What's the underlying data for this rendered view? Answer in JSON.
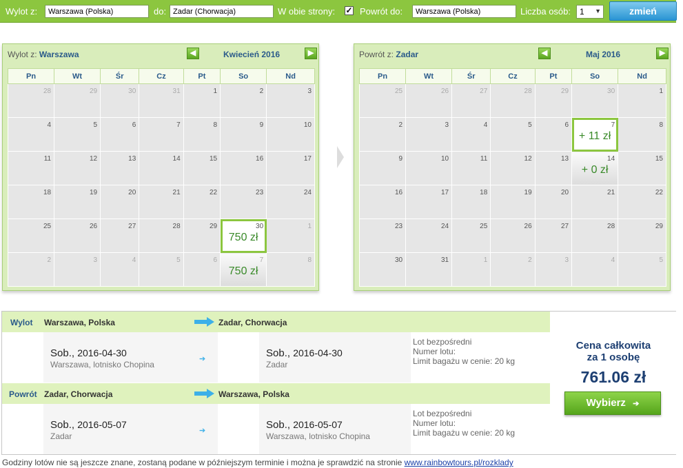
{
  "search": {
    "from_label": "Wylot z:",
    "from_value": "Warszawa (Polska)",
    "to_label": "do:",
    "to_value": "Zadar (Chorwacja)",
    "roundtrip_label": "W obie strony:",
    "roundtrip_checked": true,
    "return_label": "Powrót do:",
    "return_value": "Warszawa (Polska)",
    "persons_label": "Liczba osób:",
    "persons_value": "1",
    "change_button": "zmień"
  },
  "colors": {
    "accent": "#8cc63f",
    "price_green": "#3a8a2a",
    "navy": "#1d3f72",
    "blue_arrow": "#3cb0e8"
  },
  "weekdays": [
    "Pn",
    "Wt",
    "Śr",
    "Cz",
    "Pt",
    "So",
    "Nd"
  ],
  "calendars": [
    {
      "title_prefix": "Wylot z:",
      "title_city": "Warszawa",
      "month": "Kwiecień 2016",
      "weeks": [
        [
          {
            "d": "28",
            "o": true
          },
          {
            "d": "29",
            "o": true
          },
          {
            "d": "30",
            "o": true
          },
          {
            "d": "31",
            "o": true
          },
          {
            "d": "1"
          },
          {
            "d": "2"
          },
          {
            "d": "3"
          }
        ],
        [
          {
            "d": "4"
          },
          {
            "d": "5"
          },
          {
            "d": "6"
          },
          {
            "d": "7"
          },
          {
            "d": "8"
          },
          {
            "d": "9"
          },
          {
            "d": "10"
          }
        ],
        [
          {
            "d": "11"
          },
          {
            "d": "12"
          },
          {
            "d": "13"
          },
          {
            "d": "14"
          },
          {
            "d": "15"
          },
          {
            "d": "16"
          },
          {
            "d": "17"
          }
        ],
        [
          {
            "d": "18"
          },
          {
            "d": "19"
          },
          {
            "d": "20"
          },
          {
            "d": "21"
          },
          {
            "d": "22"
          },
          {
            "d": "23"
          },
          {
            "d": "24"
          }
        ],
        [
          {
            "d": "25"
          },
          {
            "d": "26"
          },
          {
            "d": "27"
          },
          {
            "d": "28"
          },
          {
            "d": "29"
          },
          {
            "d": "30",
            "price": "750 zł",
            "sel": true
          },
          {
            "d": "1",
            "o": true
          }
        ],
        [
          {
            "d": "2",
            "o": true
          },
          {
            "d": "3",
            "o": true
          },
          {
            "d": "4",
            "o": true
          },
          {
            "d": "5",
            "o": true
          },
          {
            "d": "6",
            "o": true
          },
          {
            "d": "7",
            "o": true,
            "price": "750 zł"
          },
          {
            "d": "8",
            "o": true
          }
        ]
      ]
    },
    {
      "title_prefix": "Powrót z:",
      "title_city": "Zadar",
      "month": "Maj 2016",
      "weeks": [
        [
          {
            "d": "25",
            "o": true
          },
          {
            "d": "26",
            "o": true
          },
          {
            "d": "27",
            "o": true
          },
          {
            "d": "28",
            "o": true
          },
          {
            "d": "29",
            "o": true
          },
          {
            "d": "30",
            "o": true
          },
          {
            "d": "1"
          }
        ],
        [
          {
            "d": "2"
          },
          {
            "d": "3"
          },
          {
            "d": "4"
          },
          {
            "d": "5"
          },
          {
            "d": "6"
          },
          {
            "d": "7",
            "price": "+ 11 zł",
            "sel": true
          },
          {
            "d": "8"
          }
        ],
        [
          {
            "d": "9"
          },
          {
            "d": "10"
          },
          {
            "d": "11"
          },
          {
            "d": "12"
          },
          {
            "d": "13"
          },
          {
            "d": "14",
            "price": "+ 0 zł"
          },
          {
            "d": "15"
          }
        ],
        [
          {
            "d": "16"
          },
          {
            "d": "17"
          },
          {
            "d": "18"
          },
          {
            "d": "19"
          },
          {
            "d": "20"
          },
          {
            "d": "21"
          },
          {
            "d": "22"
          }
        ],
        [
          {
            "d": "23"
          },
          {
            "d": "24"
          },
          {
            "d": "25"
          },
          {
            "d": "26"
          },
          {
            "d": "27"
          },
          {
            "d": "28"
          },
          {
            "d": "29"
          }
        ],
        [
          {
            "d": "30"
          },
          {
            "d": "31"
          },
          {
            "d": "1",
            "o": true
          },
          {
            "d": "2",
            "o": true
          },
          {
            "d": "3",
            "o": true
          },
          {
            "d": "4",
            "o": true
          },
          {
            "d": "5",
            "o": true
          }
        ]
      ]
    }
  ],
  "summary": {
    "outbound": {
      "leg_label": "Wylot",
      "from": "Warszawa, Polska",
      "to": "Zadar, Chorwacja",
      "dep_day": "Sob.,",
      "dep_date": "2016-04-30",
      "dep_place": "Warszawa, lotnisko Chopina",
      "arr_day": "Sob.,",
      "arr_date": "2016-04-30",
      "arr_place": "Zadar",
      "info1": "Lot bezpośredni",
      "info2": "Numer lotu:",
      "info3": "Limit bagażu w cenie: 20 kg"
    },
    "return": {
      "leg_label": "Powrót",
      "from": "Zadar, Chorwacja",
      "to": "Warszawa, Polska",
      "dep_day": "Sob.,",
      "dep_date": "2016-05-07",
      "dep_place": "Zadar",
      "arr_day": "Sob.,",
      "arr_date": "2016-05-07",
      "arr_place": "Warszawa, lotnisko Chopina",
      "info1": "Lot bezpośredni",
      "info2": "Numer lotu:",
      "info3": "Limit bagażu w cenie: 20 kg"
    },
    "total_caption_1": "Cena całkowita",
    "total_caption_2": "za 1 osobę",
    "total_amount": "761.06 zł",
    "choose_button": "Wybierz"
  },
  "footnote": {
    "text": "Godziny lotów nie są jeszcze znane, zostaną podane w późniejszym terminie i można je sprawdzić na stronie",
    "link": "www.rainbowtours.pl/rozklady"
  }
}
